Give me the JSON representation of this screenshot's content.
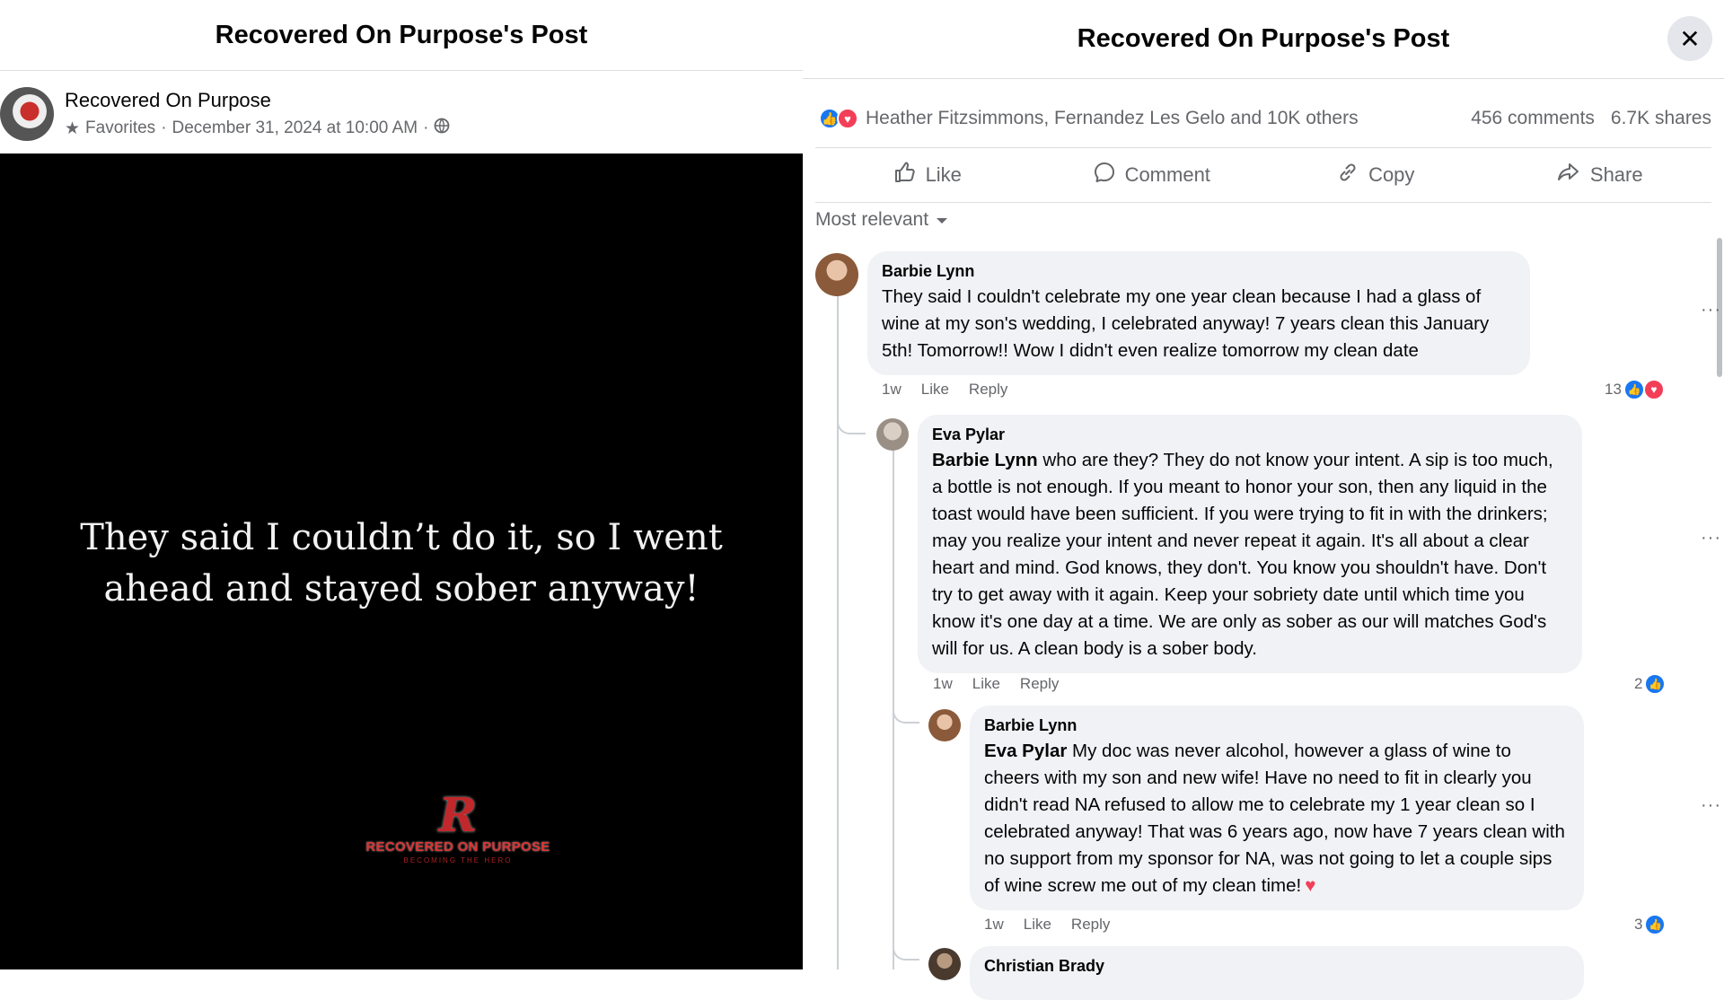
{
  "left": {
    "title": "Recovered On Purpose's Post",
    "author": "Recovered On Purpose",
    "favorites": "Favorites",
    "date": "December 31, 2024 at 10:00 AM",
    "quote_line1": "They said I couldn’t do it, so I went",
    "quote_line2": "ahead and stayed sober anyway!",
    "logo_text": "RECOVERED ON PURPOSE",
    "logo_sub": "BECOMING THE HERO"
  },
  "right": {
    "title": "Recovered On Purpose's Post",
    "close": "✕",
    "reactions_text": "Heather Fitzsimmons, Fernandez Les Gelo and 10K others",
    "comments_count": "456 comments",
    "shares_count": "6.7K shares",
    "actions": {
      "like": "Like",
      "comment": "Comment",
      "copy": "Copy",
      "share": "Share"
    },
    "sort_label": "Most relevant",
    "comments": [
      {
        "name": "Barbie Lynn",
        "text": "They said I couldn't celebrate my one year clean because I had a glass of wine at my son's wedding, I celebrated anyway! 7 years clean this January 5th! Tomorrow!! Wow I didn't even realize tomorrow my clean date",
        "time": "1w",
        "like": "Like",
        "reply": "Reply",
        "reactions": "13"
      },
      {
        "name": "Eva Pylar",
        "mention": "Barbie Lynn",
        "text": " who are they? They do not know your intent. A sip is too much, a bottle is not enough. If you meant to honor your son, then any liquid in the toast would have been sufficient. If you were trying to fit in with the drinkers; may you realize your intent and never repeat it again. It's all about a clear heart and mind. God knows, they don't. You know you shouldn't have. Don't try to get away with it again. Keep your sobriety date until which time you know it's one day at a time. We are only as sober as our will matches God's will for us. A clean body is a sober body.",
        "time": "1w",
        "like": "Like",
        "reply": "Reply",
        "reactions": "2"
      },
      {
        "name": "Barbie Lynn",
        "mention": "Eva Pylar",
        "text": " My doc was never alcohol, however a glass of wine to cheers with my son and new wife! Have no need to fit in clearly you didn't read NA refused to allow me to celebrate my 1 year clean so I celebrated anyway! That was 6 years ago, now have 7 years clean with no support from my sponsor for NA, was not going to let a couple sips of wine screw me out of my clean time!",
        "heart": "♥",
        "time": "1w",
        "like": "Like",
        "reply": "Reply",
        "reactions": "3"
      },
      {
        "name": "Christian Brady"
      }
    ]
  }
}
